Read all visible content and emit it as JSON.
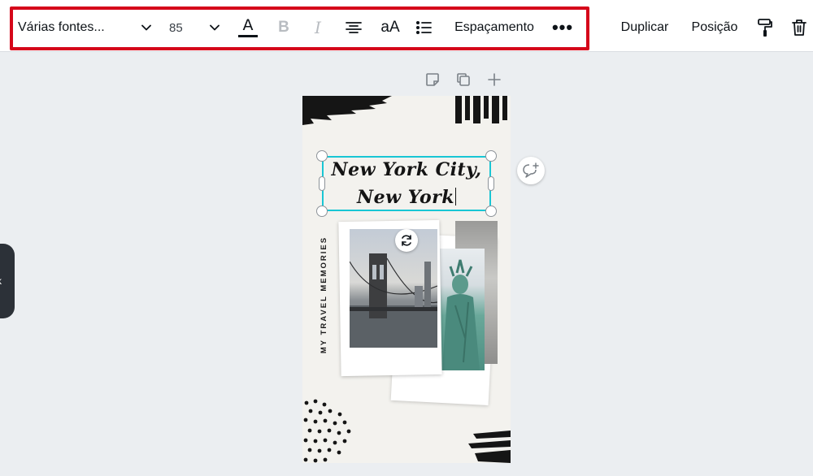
{
  "toolbar": {
    "font_family_value": "Várias fontes...",
    "font_size_value": "85",
    "text_color_letter": "A",
    "bold_label": "B",
    "italic_label": "I",
    "case_label": "aA",
    "spacing_label": "Espaçamento",
    "more_label": "•••",
    "duplicate_label": "Duplicar",
    "position_label": "Posição",
    "highlight_color": "#d5061a"
  },
  "side_tab": {
    "label": "k"
  },
  "design": {
    "title_line_1": "New York City,",
    "title_line_2": "New York",
    "vertical_caption": "MY TRAVEL MEMORIES",
    "selection_color": "#18c6d4"
  },
  "icons": {
    "text_color": "text-color-icon",
    "align": "align-center-icon",
    "list": "bulleted-list-icon",
    "paint": "paint-roller-icon",
    "trash": "trash-icon",
    "note": "note-icon",
    "copy": "copy-icon",
    "add": "plus-icon",
    "comment": "comment-add-icon",
    "rotate": "rotate-icon"
  }
}
